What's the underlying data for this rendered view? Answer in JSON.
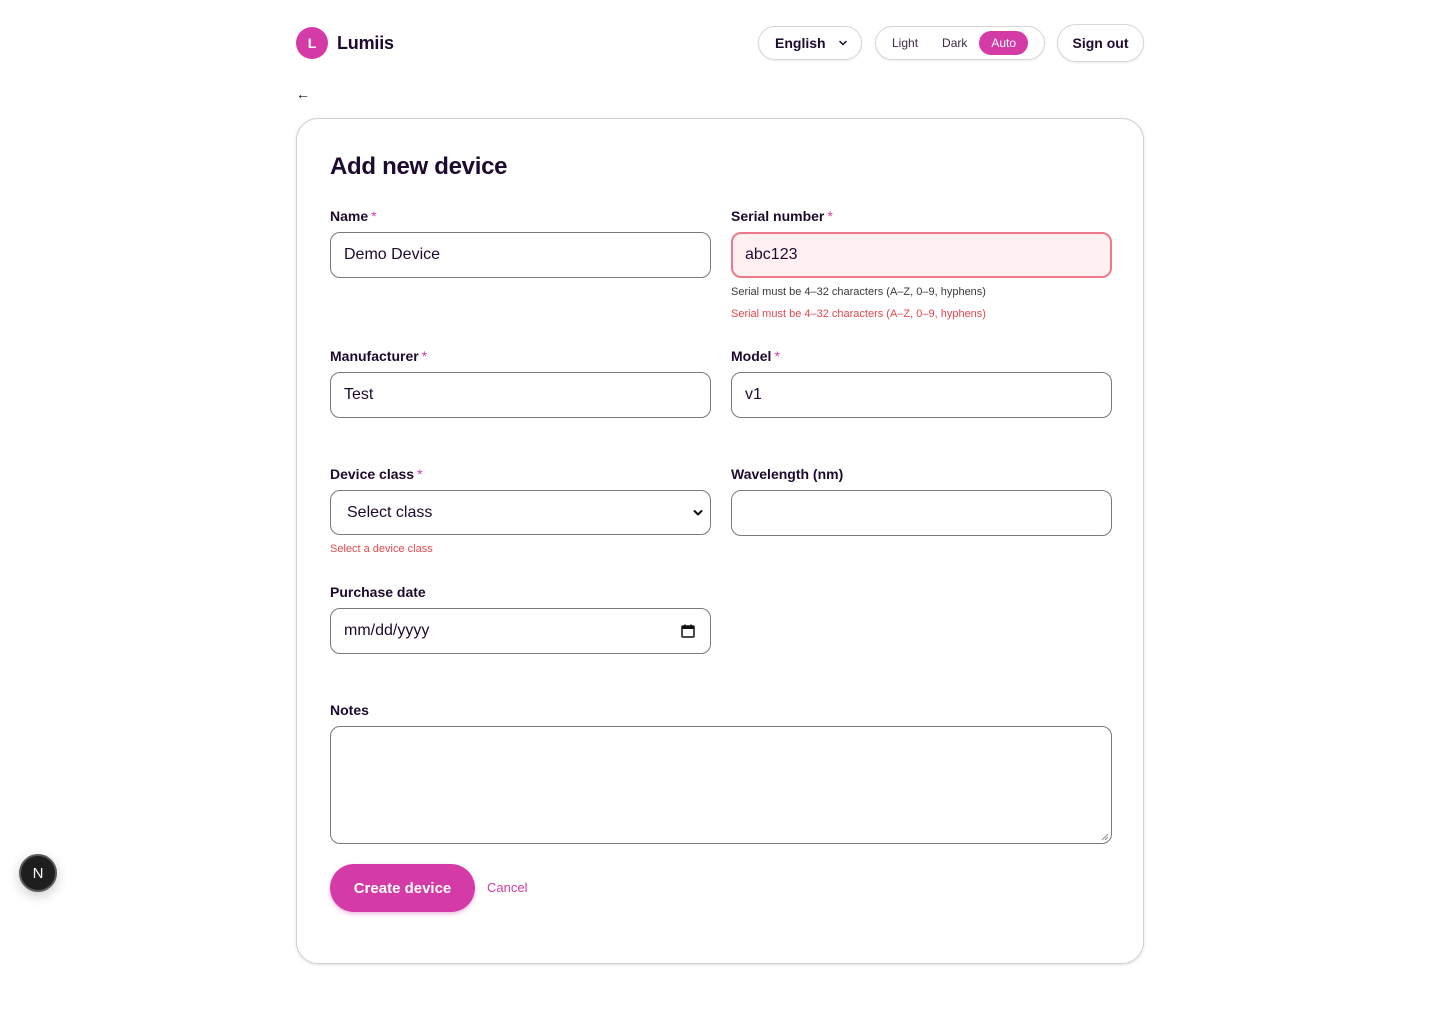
{
  "header": {
    "logo_letter": "L",
    "brand_name": "Lumiis",
    "language": "English",
    "theme_options": [
      "Light",
      "Dark",
      "Auto"
    ],
    "theme_selected": "Auto",
    "sign_out": "Sign out"
  },
  "back_arrow": "←",
  "form": {
    "title": "Add new device",
    "required_mark": "*",
    "name": {
      "label": "Name",
      "value": "Demo Device"
    },
    "serial": {
      "label": "Serial number",
      "value": "abc123",
      "hint": "Serial must be 4–32 characters (A–Z, 0–9, hyphens)",
      "error": "Serial must be 4–32 characters (A–Z, 0–9, hyphens)"
    },
    "manufacturer": {
      "label": "Manufacturer",
      "value": "Test"
    },
    "model": {
      "label": "Model",
      "value": "v1"
    },
    "device_class": {
      "label": "Device class",
      "selected": "Select class",
      "error": "Select a device class"
    },
    "wavelength": {
      "label": "Wavelength (nm)",
      "value": ""
    },
    "purchase_date": {
      "label": "Purchase date",
      "placeholder": "mm/dd/yyyy"
    },
    "notes": {
      "label": "Notes",
      "value": ""
    },
    "create_button": "Create device",
    "cancel_link": "Cancel"
  },
  "dev_badge": "N",
  "colors": {
    "accent": "#d43ba6",
    "error": "#e5484d",
    "error_bg": "#fff1f2",
    "text": "#1e0a2e"
  }
}
